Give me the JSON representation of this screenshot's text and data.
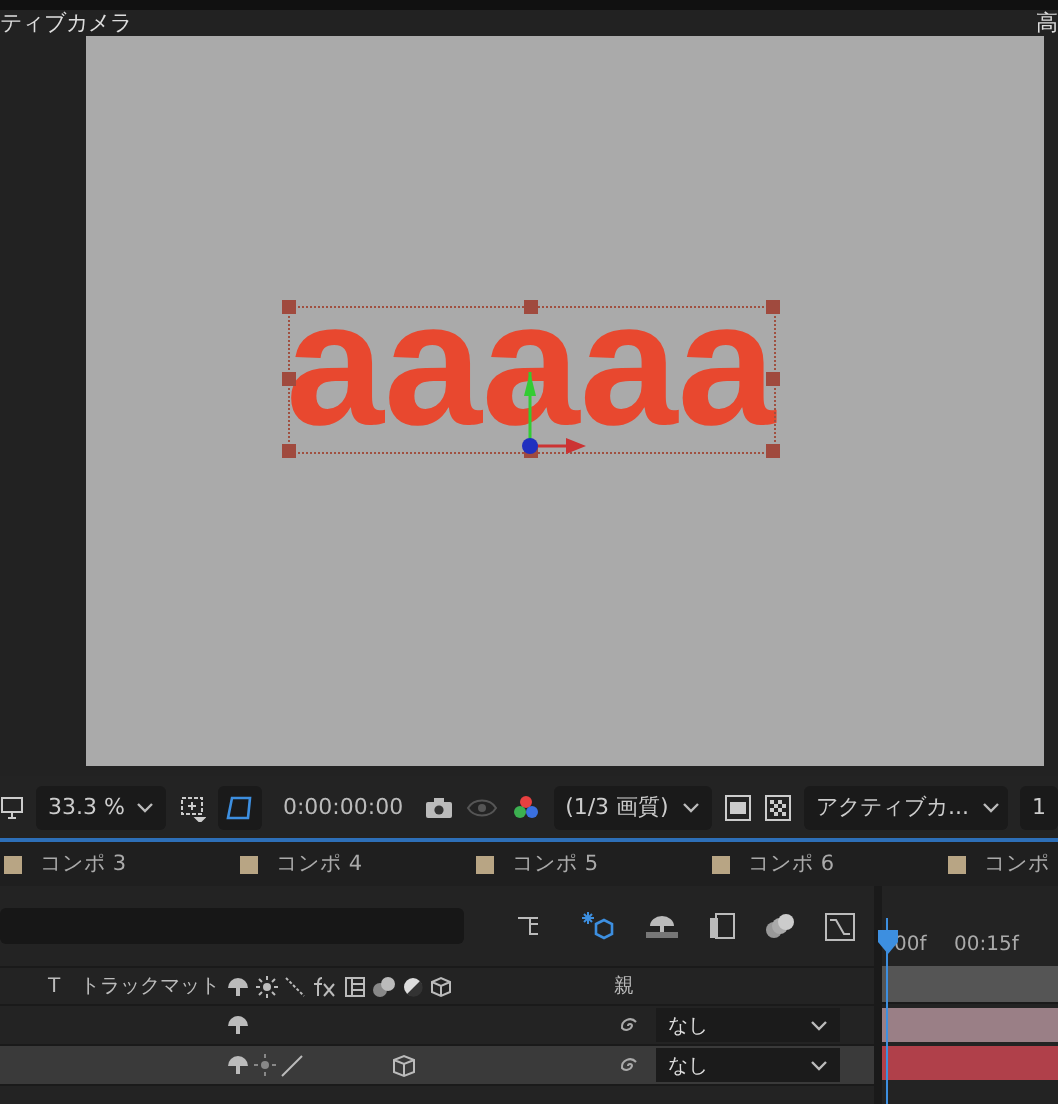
{
  "viewer": {
    "camera_label": "ティブカメラ",
    "right_label": "高",
    "text_layer": "aaaaa",
    "layer_selected": true
  },
  "toolbar": {
    "zoom": "33.3 %",
    "timecode": "0:00:00:00",
    "resolution": "(1/3 画質)",
    "view": "アクティブカ...",
    "view_count": "1"
  },
  "comp_tabs": [
    {
      "label": "コンポ 3",
      "color": "#b8a584"
    },
    {
      "label": "コンポ 4",
      "color": "#b8a584"
    },
    {
      "label": "コンポ 5",
      "color": "#b8a584"
    },
    {
      "label": "コンポ 6",
      "color": "#b8a584"
    },
    {
      "label": "コンポ",
      "color": "#b8a584"
    }
  ],
  "timeline": {
    "draft_3d": true,
    "ruler": [
      "00f",
      "00:15f"
    ],
    "columns": {
      "type": "T",
      "track_matte": "トラックマット",
      "parent": "親"
    },
    "layers": [
      {
        "selected": false,
        "kind": "text",
        "parent": "なし",
        "color": "#9a7f86"
      },
      {
        "selected": true,
        "kind": "shape",
        "parent": "なし",
        "color": "#b0404a"
      }
    ]
  }
}
